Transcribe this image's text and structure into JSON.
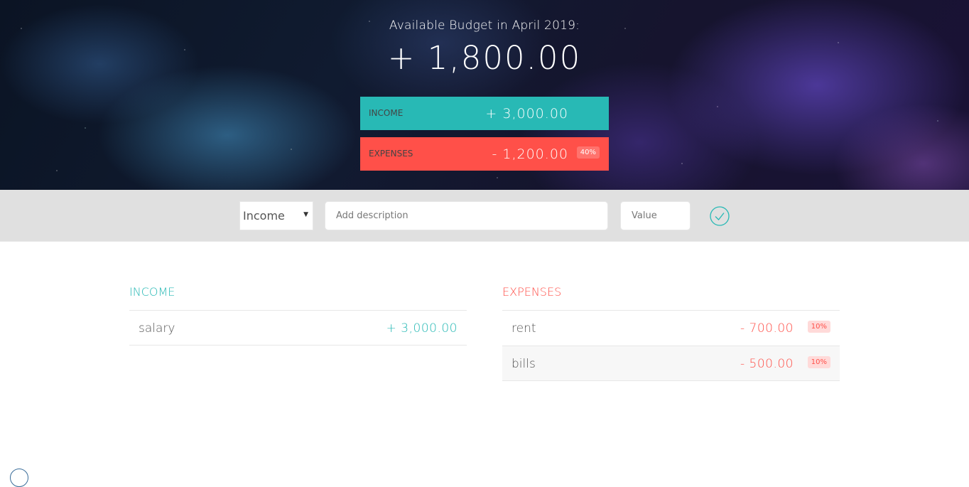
{
  "budget": {
    "title": "Available Budget in April 2019:",
    "value": "+ 1,800.00"
  },
  "summary": {
    "income_label": "Income",
    "income_value": "+ 3,000.00",
    "expenses_label": "Expenses",
    "expenses_value": "- 1,200.00",
    "expenses_percentage": "40%"
  },
  "add": {
    "type_selected": "Income",
    "description_placeholder": "Add description",
    "value_placeholder": "Value",
    "submit_icon": "checkmark-circle-icon"
  },
  "income": {
    "title": "Income",
    "items": [
      {
        "description": "salary",
        "value": "+ 3,000.00"
      }
    ]
  },
  "expenses": {
    "title": "Expenses",
    "items": [
      {
        "description": "rent",
        "value": "- 700.00",
        "percentage": "10%"
      },
      {
        "description": "bills",
        "value": "- 500.00",
        "percentage": "10%"
      }
    ]
  },
  "colors": {
    "income": "#28b9b5",
    "expenses": "#ff5049",
    "add_bar": "#e0e0e0"
  }
}
